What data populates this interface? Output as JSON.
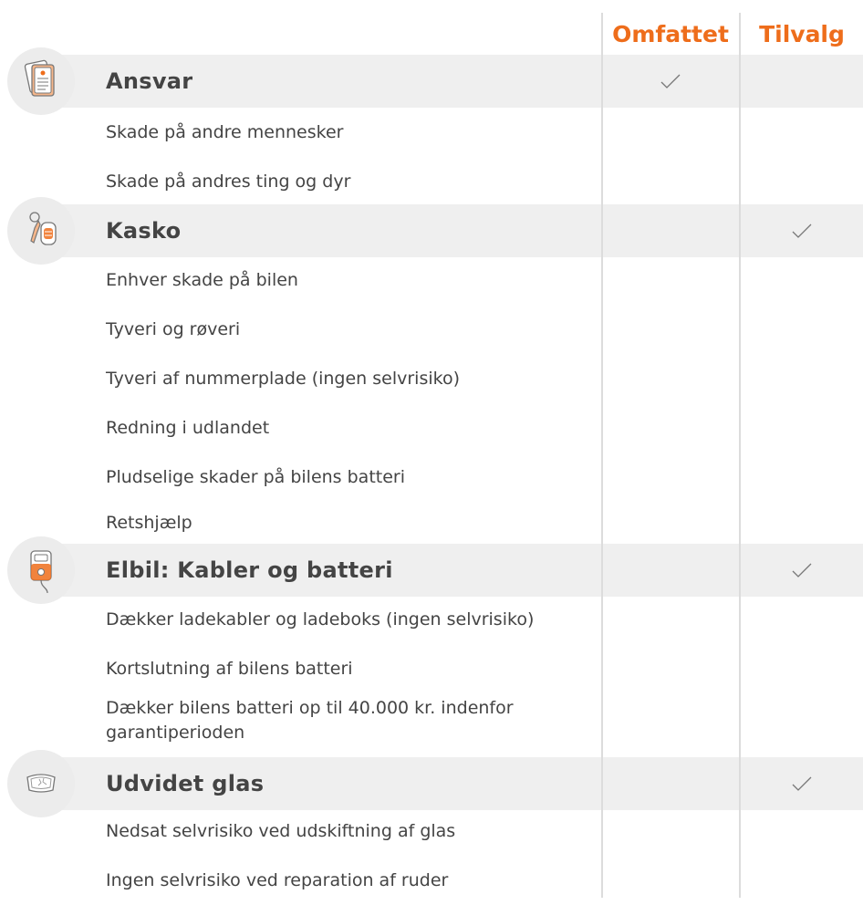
{
  "columns": {
    "included": "Omfattet",
    "optional": "Tilvalg"
  },
  "colors": {
    "accent": "#ee6d1b",
    "group_band": "#efefef",
    "divider": "#dcdcdc",
    "icon_bg": "#ececec"
  },
  "groups": [
    {
      "title": "Ansvar",
      "icon": "document-icon",
      "included": true,
      "optional": false,
      "items": [
        "Skade på andre mennesker",
        "Skade på andres ting og dyr"
      ]
    },
    {
      "title": "Kasko",
      "icon": "car-keys-icon",
      "included": false,
      "optional": true,
      "items": [
        "Enhver skade på bilen",
        "Tyveri og røveri",
        "Tyveri af nummerplade (ingen selvrisiko)",
        "Redning i udlandet",
        "Pludselige skader på bilens batteri",
        "Retshjælp"
      ]
    },
    {
      "title": "Elbil: Kabler og batteri",
      "icon": "charging-station-icon",
      "included": false,
      "optional": true,
      "items": [
        "Dækker ladekabler og ladeboks (ingen selvrisiko)",
        "Kortslutning af bilens batteri",
        "Dækker bilens batteri op til 40.000 kr. indenfor garantiperioden"
      ]
    },
    {
      "title": "Udvidet glas",
      "icon": "windshield-icon",
      "included": false,
      "optional": true,
      "items": [
        "Nedsat selvrisiko ved udskiftning af glas",
        "Ingen selvrisiko ved reparation af ruder"
      ]
    }
  ]
}
